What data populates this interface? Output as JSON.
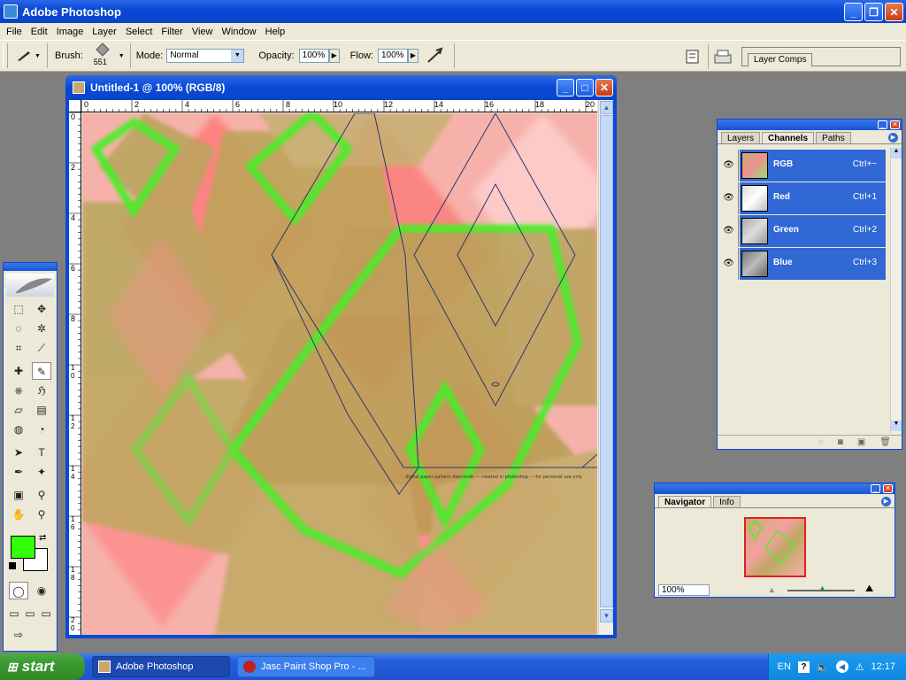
{
  "app": {
    "title": "Adobe Photoshop"
  },
  "menu": [
    "File",
    "Edit",
    "Image",
    "Layer",
    "Select",
    "Filter",
    "View",
    "Window",
    "Help"
  ],
  "options": {
    "brush_label": "Brush:",
    "brush_size": "551",
    "mode_label": "Mode:",
    "mode_value": "Normal",
    "opacity_label": "Opacity:",
    "opacity_value": "100%",
    "flow_label": "Flow:",
    "flow_value": "100%",
    "layer_comps_tab": "Layer Comps"
  },
  "document": {
    "title": "Untitled-1 @ 100% (RGB/8)",
    "ruler_h_ticks": [
      "0",
      "2",
      "4",
      "6",
      "8",
      "10",
      "12",
      "14",
      "16",
      "18",
      "20"
    ],
    "ruler_v_ticks": [
      "0",
      "2",
      "4",
      "6",
      "8",
      "10",
      "12",
      "14",
      "16",
      "18",
      "20"
    ],
    "canvas_caption": "digital paper pattern diamonds — created in photoshop — for personal use only"
  },
  "channels_panel": {
    "tabs": [
      "Layers",
      "Channels",
      "Paths"
    ],
    "active_tab": "Channels",
    "rows": [
      {
        "name": "RGB",
        "shortcut": "Ctrl+~"
      },
      {
        "name": "Red",
        "shortcut": "Ctrl+1"
      },
      {
        "name": "Green",
        "shortcut": "Ctrl+2"
      },
      {
        "name": "Blue",
        "shortcut": "Ctrl+3"
      }
    ]
  },
  "navigator_panel": {
    "tabs": [
      "Navigator",
      "Info"
    ],
    "active_tab": "Navigator",
    "zoom": "100%"
  },
  "colors": {
    "foreground": "#33ff0a",
    "background": "#ffffff",
    "xp_blue": "#0a48d6",
    "panel_bg": "#ece9d8",
    "selected_row": "#3168d5"
  },
  "taskbar": {
    "start": "start",
    "tasks": [
      "Adobe Photoshop",
      "Jasc Paint Shop Pro - ..."
    ],
    "lang": "EN",
    "time": "12:17"
  }
}
